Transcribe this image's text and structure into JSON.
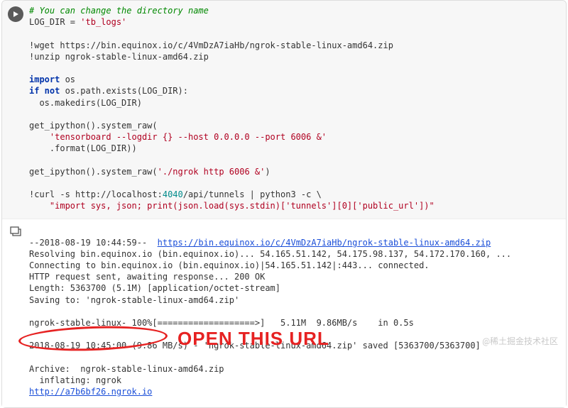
{
  "code": {
    "lines": [
      {
        "t": "comment",
        "v": "# You can change the directory name"
      },
      {
        "t": "assign",
        "lhs": "LOG_DIR = ",
        "rhs": "'tb_logs'"
      },
      {
        "t": "blank"
      },
      {
        "t": "shell",
        "v": "!wget https://bin.equinox.io/c/4VmDzA7iaHb/ngrok-stable-linux-amd64.zip"
      },
      {
        "t": "shell",
        "v": "!unzip ngrok-stable-linux-amd64.zip"
      },
      {
        "t": "blank"
      },
      {
        "t": "import",
        "kw": "import",
        "mod": " os"
      },
      {
        "t": "ifnot",
        "kw1": "if not",
        "mid": " os.path.exists(LOG_DIR):"
      },
      {
        "t": "indent",
        "v": "  os.makedirs(LOG_DIR)"
      },
      {
        "t": "blank"
      },
      {
        "t": "plain",
        "v": "get_ipython().system_raw("
      },
      {
        "t": "strindent",
        "v": "    'tensorboard --logdir {} --host 0.0.0.0 --port 6006 &'"
      },
      {
        "t": "plain",
        "v": "    .format(LOG_DIR))"
      },
      {
        "t": "blank"
      },
      {
        "t": "mixed",
        "pre": "get_ipython().system_raw(",
        "str": "'./ngrok http 6006 &'",
        "post": ")"
      },
      {
        "t": "blank"
      },
      {
        "t": "curl",
        "pre": "!curl -s http://localhost:",
        "num": "4040",
        "mid": "/api/tunnels | python3 -c \\"
      },
      {
        "t": "strindent",
        "v": "    \"import sys, json; print(json.load(sys.stdin)['tunnels'][0]['public_url'])\""
      }
    ]
  },
  "output": {
    "timestamp": "--2018-08-19 10:44:59--  ",
    "wget_url": "https://bin.equinox.io/c/4VmDzA7iaHb/ngrok-stable-linux-amd64.zip",
    "line_resolve": "Resolving bin.equinox.io (bin.equinox.io)... 54.165.51.142, 54.175.98.137, 54.172.170.160, ...",
    "line_connect": "Connecting to bin.equinox.io (bin.equinox.io)|54.165.51.142|:443... connected.",
    "line_http": "HTTP request sent, awaiting response... 200 OK",
    "line_length": "Length: 5363700 (5.1M) [application/octet-stream]",
    "line_saving": "Saving to: 'ngrok-stable-linux-amd64.zip'",
    "line_progress": "ngrok-stable-linux- 100%[===================>]   5.11M  9.86MB/s    in 0.5s",
    "line_saved": "2018-08-19 10:45:00 (9.86 MB/s) - 'ngrok-stable-linux-amd64.zip' saved [5363700/5363700]",
    "line_archive": "Archive:  ngrok-stable-linux-amd64.zip",
    "line_inflate": "  inflating: ngrok",
    "ngrok_url": "http://a7b6bf26.ngrok.io"
  },
  "annotation": {
    "label": "OPEN THIS URL"
  },
  "watermark": "@稀土掘金技术社区"
}
